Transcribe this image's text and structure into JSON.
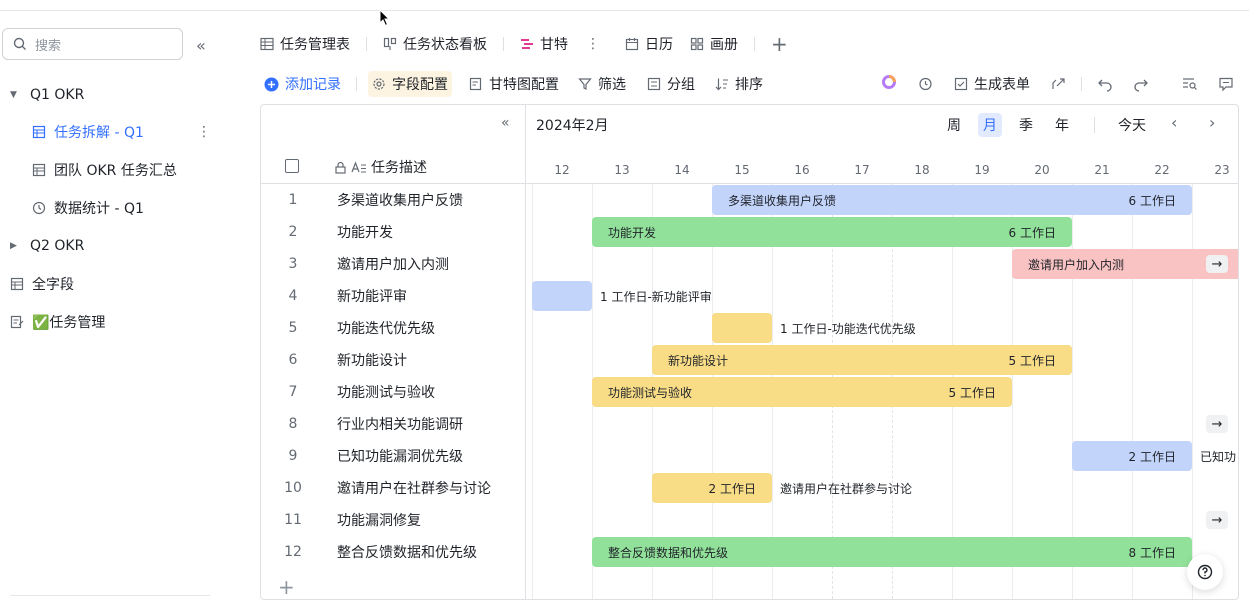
{
  "sidebar": {
    "search_placeholder": "搜索",
    "items": [
      {
        "label": "Q1 OKR",
        "type": "group",
        "expanded": true,
        "icon": "caret-down-icon"
      },
      {
        "label": "任务拆解 - Q1",
        "type": "gantt",
        "active": true,
        "icon": "table-icon"
      },
      {
        "label": "团队 OKR 任务汇总",
        "type": "table",
        "icon": "table-icon"
      },
      {
        "label": "数据统计 - Q1",
        "type": "dashboard",
        "icon": "clock-icon"
      },
      {
        "label": "Q2 OKR",
        "type": "group",
        "expanded": false,
        "icon": "caret-right-icon"
      },
      {
        "label": "全字段",
        "type": "table",
        "icon": "table-icon"
      },
      {
        "label": "✅任务管理",
        "type": "form",
        "icon": "form-icon"
      }
    ]
  },
  "tabs": [
    {
      "label": "任务管理表",
      "icon": "grid-table-icon"
    },
    {
      "label": "任务状态看板",
      "icon": "kanban-icon"
    },
    {
      "label": "甘特",
      "icon": "gantt-icon",
      "active": true
    },
    {
      "label": "日历",
      "icon": "calendar-icon"
    },
    {
      "label": "画册",
      "icon": "gallery-icon"
    }
  ],
  "toolbar": {
    "add_record": "添加记录",
    "field_config": "字段配置",
    "gantt_config": "甘特图配置",
    "filter": "筛选",
    "group": "分组",
    "sort": "排序",
    "generate_form": "生成表单"
  },
  "gantt": {
    "column_header": "任务描述",
    "month": "2024年2月",
    "scales": [
      "周",
      "月",
      "季",
      "年"
    ],
    "selected_scale": "月",
    "today": "今天",
    "days": [
      "12",
      "13",
      "14",
      "15",
      "16",
      "17",
      "18",
      "19",
      "20",
      "21",
      "22",
      "23"
    ],
    "rows": [
      {
        "num": "1",
        "desc": "多渠道收集用户反馈"
      },
      {
        "num": "2",
        "desc": "功能开发"
      },
      {
        "num": "3",
        "desc": "邀请用户加入内测"
      },
      {
        "num": "4",
        "desc": "新功能评审"
      },
      {
        "num": "5",
        "desc": "功能迭代优先级"
      },
      {
        "num": "6",
        "desc": "新功能设计"
      },
      {
        "num": "7",
        "desc": "功能测试与验收"
      },
      {
        "num": "8",
        "desc": "行业内相关功能调研"
      },
      {
        "num": "9",
        "desc": "已知功能漏洞优先级"
      },
      {
        "num": "10",
        "desc": "邀请用户在社群参与讨论"
      },
      {
        "num": "11",
        "desc": "功能漏洞修复"
      },
      {
        "num": "12",
        "desc": "整合反馈数据和优先级"
      }
    ],
    "bars": {
      "b1": {
        "label": "多渠道收集用户反馈",
        "dur": "6 工作日"
      },
      "b2": {
        "label": "功能开发",
        "dur": "6 工作日"
      },
      "b3": {
        "label": "邀请用户加入内测"
      },
      "b4": {
        "outside": "1 工作日-新功能评审"
      },
      "b5": {
        "outside": "1 工作日-功能迭代优先级"
      },
      "b6": {
        "label": "新功能设计",
        "dur": "5 工作日"
      },
      "b7": {
        "label": "功能测试与验收",
        "dur": "5 工作日"
      },
      "b9": {
        "dur": "2 工作日",
        "outside": "已知功"
      },
      "b10": {
        "dur": "2 工作日",
        "outside": "邀请用户在社群参与讨论"
      },
      "b12": {
        "label": "整合反馈数据和优先级",
        "dur": "8 工作日"
      }
    },
    "arrow": "→"
  },
  "help": "?"
}
